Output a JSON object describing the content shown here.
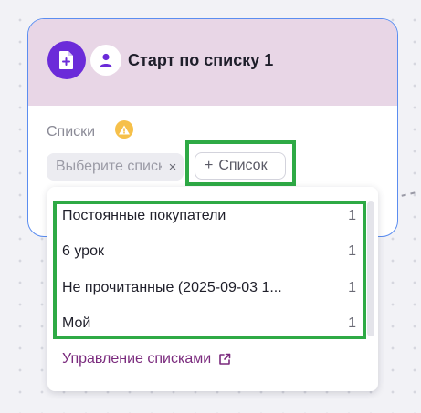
{
  "node": {
    "title": "Старт по списку 1",
    "lists_label": "Списки",
    "select_placeholder": "Выберите списки",
    "clear_symbol": "×",
    "add_list_label": "Список",
    "add_symbol": "+"
  },
  "dropdown": {
    "items": [
      {
        "name": "Постоянные покупатели",
        "count": "1"
      },
      {
        "name": "6 урок",
        "count": "1"
      },
      {
        "name": "Не прочитанные (2025-09-03 1...",
        "count": "1"
      },
      {
        "name": "Мой",
        "count": "1"
      }
    ],
    "manage_link": "Управление списками"
  },
  "colors": {
    "accent_purple": "#6b2bd9",
    "header_bg": "#e8d6e6",
    "card_border": "#5b8df0",
    "warning": "#f6c04a",
    "link": "#7a2a7d",
    "highlight": "#2eaa45"
  },
  "icons": {
    "main": "document-plus-icon",
    "user": "user-icon",
    "warning": "warning-triangle-icon",
    "external": "external-link-icon"
  }
}
